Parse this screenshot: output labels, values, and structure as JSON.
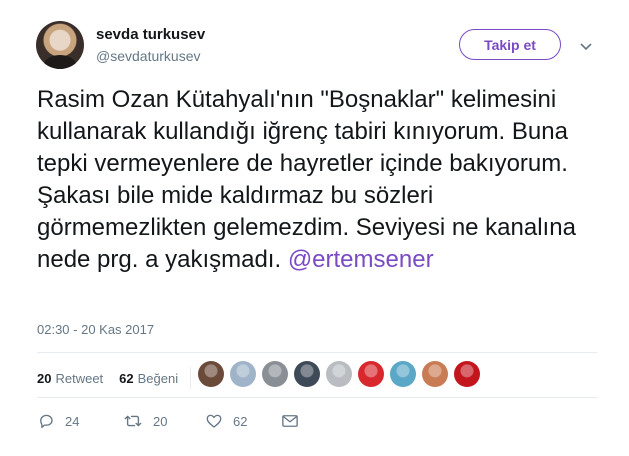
{
  "user": {
    "display_name": "sevda turkusev",
    "handle": "@sevdaturkusev"
  },
  "follow_button": {
    "label": "Takip et"
  },
  "tweet": {
    "text_before_mention": "Rasim Ozan Kütahyalı'nın \"Boşnaklar\" kelimesini kullanarak kullandığı iğrenç tabiri kınıyorum. Buna tepki vermeyenlere de hayretler içinde bakıyorum. Şakası bile mide kaldırmaz bu sözleri görmemezlikten gelemezdim. Seviyesi ne kanalına nede prg. a yakışmadı.",
    "mention": "@ertemsener",
    "timestamp": "02:30 - 20 Kas 2017"
  },
  "stats": {
    "retweet_count": "20",
    "retweet_label": "Retweet",
    "like_count": "62",
    "like_label": "Beğeni"
  },
  "liker_avatars": [
    {
      "name": "liker-avatar-1",
      "color": "#6b4a3a"
    },
    {
      "name": "liker-avatar-2",
      "color": "#9fb4c8"
    },
    {
      "name": "liker-avatar-3",
      "color": "#8a8f96"
    },
    {
      "name": "liker-avatar-4",
      "color": "#3f4a59"
    },
    {
      "name": "liker-avatar-5",
      "color": "#b9bdc2"
    },
    {
      "name": "liker-avatar-6",
      "color": "#d8282e"
    },
    {
      "name": "liker-avatar-7",
      "color": "#5aa7c7"
    },
    {
      "name": "liker-avatar-8",
      "color": "#c97b53"
    },
    {
      "name": "liker-avatar-9",
      "color": "#c3151c"
    }
  ],
  "actions": {
    "reply_count": "24",
    "retweet_count": "20",
    "like_count": "62"
  },
  "colors": {
    "accent": "#794bc4",
    "muted": "#657786",
    "text": "#14171a",
    "divider": "#e6ecf0"
  }
}
